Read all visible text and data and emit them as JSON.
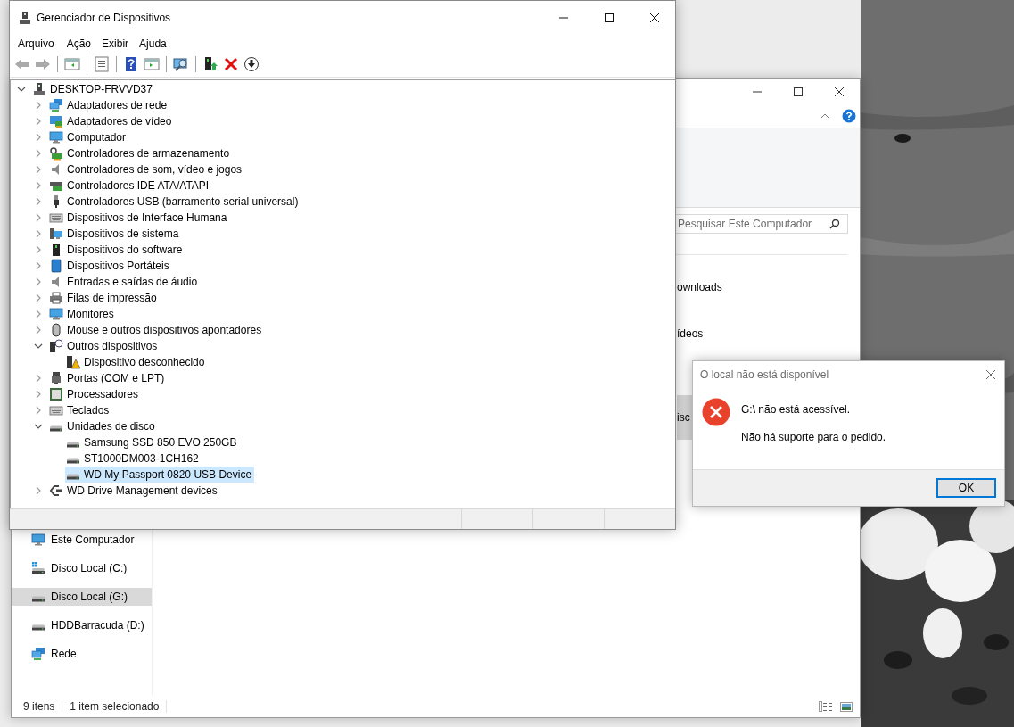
{
  "device_manager": {
    "title": "Gerenciador de Dispositivos",
    "menu": [
      "Arquivo",
      "Ação",
      "Exibir",
      "Ajuda"
    ],
    "toolbar_groups": [
      [
        {
          "kind": "back",
          "disabled": true
        },
        {
          "kind": "forward",
          "disabled": true
        }
      ],
      [
        {
          "kind": "console_tree",
          "disabled": false
        }
      ],
      [
        {
          "kind": "properties",
          "disabled": false
        }
      ],
      [
        {
          "kind": "help",
          "disabled": false
        },
        {
          "kind": "action_pane",
          "disabled": false
        }
      ],
      [
        {
          "kind": "scan",
          "disabled": false
        }
      ],
      [
        {
          "kind": "update_driver",
          "disabled": false
        },
        {
          "kind": "uninstall",
          "disabled": false
        },
        {
          "kind": "disable",
          "disabled": false
        }
      ]
    ],
    "tree": {
      "label": "DESKTOP-FRVVD37",
      "kind": "computer",
      "expanded": true,
      "selected": false,
      "children": [
        {
          "label": "Adaptadores de rede",
          "kind": "network",
          "expanded": false,
          "selected": false
        },
        {
          "label": "Adaptadores de vídeo",
          "kind": "display",
          "expanded": false,
          "selected": false
        },
        {
          "label": "Computador",
          "kind": "monitor",
          "expanded": false,
          "selected": false
        },
        {
          "label": "Controladores de armazenamento",
          "kind": "storage",
          "expanded": false,
          "selected": false
        },
        {
          "label": "Controladores de som, vídeo e jogos",
          "kind": "sound",
          "expanded": false,
          "selected": false
        },
        {
          "label": "Controladores IDE ATA/ATAPI",
          "kind": "ide",
          "expanded": false,
          "selected": false
        },
        {
          "label": "Controladores USB (barramento serial universal)",
          "kind": "usb",
          "expanded": false,
          "selected": false
        },
        {
          "label": "Dispositivos de Interface Humana",
          "kind": "keyboard",
          "expanded": false,
          "selected": false
        },
        {
          "label": "Dispositivos de sistema",
          "kind": "system",
          "expanded": false,
          "selected": false
        },
        {
          "label": "Dispositivos do software",
          "kind": "software",
          "expanded": false,
          "selected": false
        },
        {
          "label": "Dispositivos Portáteis",
          "kind": "portable",
          "expanded": false,
          "selected": false
        },
        {
          "label": "Entradas e saídas de áudio",
          "kind": "sound",
          "expanded": false,
          "selected": false
        },
        {
          "label": "Filas de impressão",
          "kind": "printer",
          "expanded": false,
          "selected": false
        },
        {
          "label": "Monitores",
          "kind": "monitor",
          "expanded": false,
          "selected": false
        },
        {
          "label": "Mouse e outros dispositivos apontadores",
          "kind": "mouse",
          "expanded": false,
          "selected": false
        },
        {
          "label": "Outros dispositivos",
          "kind": "other",
          "expanded": true,
          "selected": false,
          "children": [
            {
              "label": "Dispositivo desconhecido",
              "kind": "unknown",
              "selected": false
            }
          ]
        },
        {
          "label": "Portas (COM e LPT)",
          "kind": "port",
          "expanded": false,
          "selected": false
        },
        {
          "label": "Processadores",
          "kind": "cpu",
          "expanded": false,
          "selected": false
        },
        {
          "label": "Teclados",
          "kind": "keyboard",
          "expanded": false,
          "selected": false
        },
        {
          "label": "Unidades de disco",
          "kind": "disk",
          "expanded": true,
          "selected": false,
          "children": [
            {
              "label": "Samsung SSD 850 EVO 250GB",
              "kind": "disk",
              "selected": false
            },
            {
              "label": "ST1000DM003-1CH162",
              "kind": "disk",
              "selected": false
            },
            {
              "label": "WD My Passport 0820 USB Device",
              "kind": "disk",
              "selected": true
            }
          ]
        },
        {
          "label": "WD Drive Management devices",
          "kind": "connector",
          "expanded": false,
          "selected": false
        }
      ]
    }
  },
  "explorer": {
    "search": {
      "placeholder": "Pesquisar Este Computador"
    },
    "folders": [
      {
        "label": "ownloads",
        "selected": false
      },
      {
        "label": "ídeos",
        "selected": false
      }
    ],
    "drives": [
      {
        "label": "isc",
        "selected": true
      }
    ],
    "nav_items": [
      {
        "label": "Este Computador",
        "kind": "computer",
        "selected": false
      },
      {
        "label": "Disco Local (C:)",
        "kind": "system_drive",
        "selected": false
      },
      {
        "label": "Disco Local (G:)",
        "kind": "drive",
        "selected": true
      },
      {
        "label": "HDDBarracuda (D:)",
        "kind": "drive",
        "selected": false
      },
      {
        "label": "Rede",
        "kind": "network",
        "selected": false
      }
    ],
    "status_bar": {
      "item_count": "9 itens",
      "selection": "1 item selecionado"
    }
  },
  "dialog": {
    "title": "O local não está disponível",
    "message": "G:\\ não está acessível.",
    "detail": "Não há suporte para o pedido.",
    "buttons": [
      "OK"
    ]
  }
}
